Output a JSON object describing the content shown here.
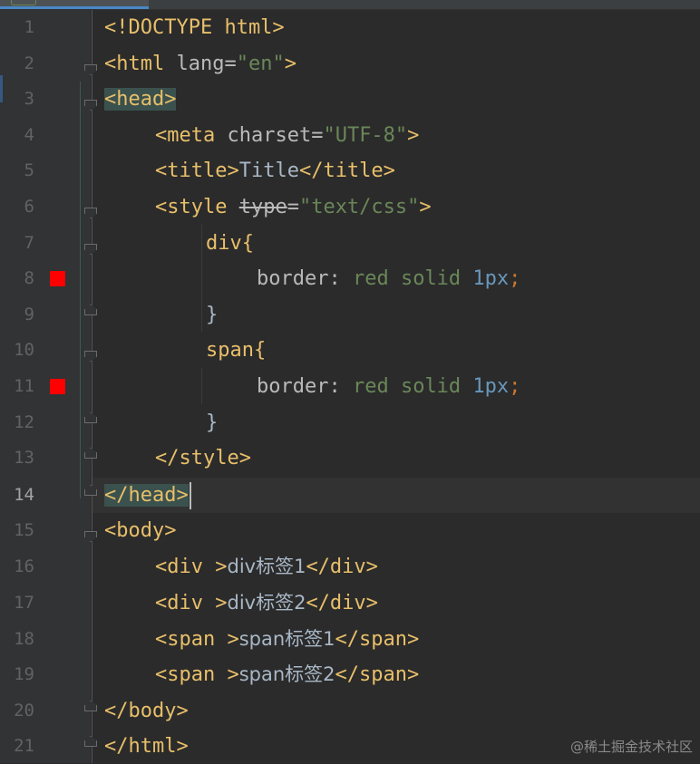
{
  "editor": {
    "current_line": 14,
    "lines": [
      {
        "no": "1",
        "text": "<!DOCTYPE html>"
      },
      {
        "no": "2",
        "text": "<html lang=\"en\">"
      },
      {
        "no": "3",
        "text": "<head>"
      },
      {
        "no": "4",
        "text": "<meta charset=\"UTF-8\">"
      },
      {
        "no": "5",
        "text": "<title>Title</title>"
      },
      {
        "no": "6",
        "text": "<style type=\"text/css\">"
      },
      {
        "no": "7",
        "text": "div{"
      },
      {
        "no": "8",
        "text": "border: red solid 1px;"
      },
      {
        "no": "9",
        "text": "}"
      },
      {
        "no": "10",
        "text": "span{"
      },
      {
        "no": "11",
        "text": "border: red solid 1px;"
      },
      {
        "no": "12",
        "text": "}"
      },
      {
        "no": "13",
        "text": "</style>"
      },
      {
        "no": "14",
        "text": "</head>"
      },
      {
        "no": "15",
        "text": "<body>"
      },
      {
        "no": "16",
        "text": "<div >div标签1</div>"
      },
      {
        "no": "17",
        "text": "<div >div标签2</div>"
      },
      {
        "no": "18",
        "text": "<span >span标签1</span>"
      },
      {
        "no": "19",
        "text": "<span >span标签2</span>"
      },
      {
        "no": "20",
        "text": "</body>"
      },
      {
        "no": "21",
        "text": "</html>"
      }
    ],
    "tokens": {
      "l1": "<!DOCTYPE html>",
      "l2_open": "<html",
      "l2_attr": " lang=",
      "l2_val": "\"en\"",
      "l2_close": ">",
      "l3": "<head>",
      "l4_open": "<meta",
      "l4_attr": " charset=",
      "l4_val": "\"UTF-8\"",
      "l4_close": ">",
      "l5_open": "<title>",
      "l5_text": "Title",
      "l5_close": "</title>",
      "l6_open": "<style ",
      "l6_attr": "type",
      "l6_eq": "=",
      "l6_val": "\"text/css\"",
      "l6_close": ">",
      "l7": "div{",
      "l8_prop": "border: ",
      "l8_v1": "red solid ",
      "l8_num": "1px",
      "l8_semi": ";",
      "l9": "}",
      "l10": "span{",
      "l11_prop": "border: ",
      "l11_v1": "red solid ",
      "l11_num": "1px",
      "l11_semi": ";",
      "l12": "}",
      "l13": "</style>",
      "l14": "</head>",
      "l15": "<body>",
      "l16_open": "<div >",
      "l16_text": "div标签1",
      "l16_close": "</div>",
      "l17_open": "<div >",
      "l17_text": "div标签2",
      "l17_close": "</div>",
      "l18_open": "<span >",
      "l18_text": "span标签1",
      "l18_close": "</span>",
      "l19_open": "<span >",
      "l19_text": "span标签2",
      "l19_close": "</span>",
      "l20": "</body>",
      "l21": "</html>"
    },
    "breakpoint_lines": [
      "8",
      "11"
    ],
    "colors": {
      "background": "#2b2b2b",
      "gutter": "#313335",
      "tag": "#e8bf6a",
      "string": "#6a8759",
      "number": "#6897bb",
      "text": "#a9b7c6",
      "breakpoint": "#ff0000",
      "tag_match": "#3b514d"
    }
  },
  "watermark": "@稀土掘金技术社区"
}
